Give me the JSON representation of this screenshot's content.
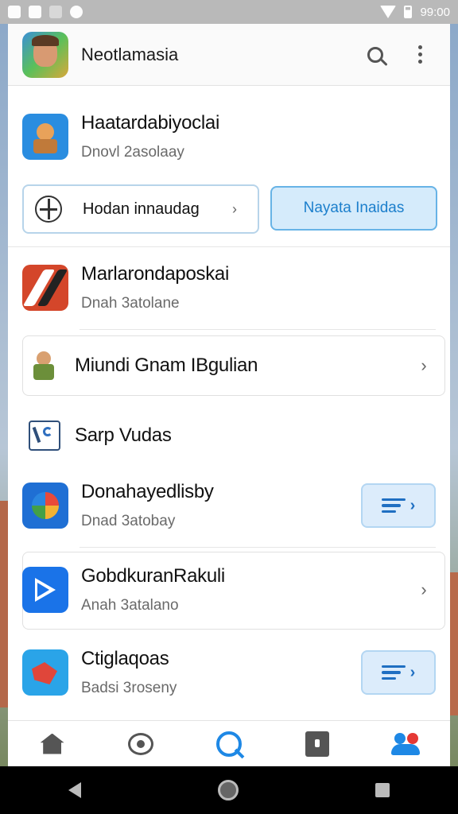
{
  "statusbar": {
    "time": "99:00"
  },
  "appbar": {
    "title": "Neotlamasia"
  },
  "featured": {
    "title": "Haatardabiyoclai",
    "subtitle": "Dnovl 2asolaay"
  },
  "buttons": {
    "outline_label": "Hodan innaudag",
    "filled_label": "Nayata Inaidas"
  },
  "items": [
    {
      "title": "Marlarondaposkai",
      "subtitle": "Dnah 3atolane"
    },
    {
      "title": "Miundi Gnam IBgulian"
    },
    {
      "title": "Sarp Vudas"
    },
    {
      "title": "Donahayedlisby",
      "subtitle": "Dnad 3atobay"
    },
    {
      "title": "GobdkuranRakuli",
      "subtitle": "Anah 3atalano"
    },
    {
      "title": "Ctiglaqoas",
      "subtitle": "Badsi 3roseny"
    }
  ],
  "colors": {
    "accent": "#1e88e5",
    "chip_bg": "#dcecfb",
    "button_fill": "#d5ebfb"
  },
  "icons": {
    "status": [
      "screenshot-icon",
      "image-icon",
      "sim-icon",
      "sync-icon",
      "wifi-icon",
      "battery-icon"
    ],
    "bottom_nav": [
      "home-icon",
      "camera-icon",
      "discover-icon",
      "book-icon",
      "people-icon"
    ],
    "system_nav": [
      "back-icon",
      "home-button-icon",
      "recents-icon"
    ]
  }
}
